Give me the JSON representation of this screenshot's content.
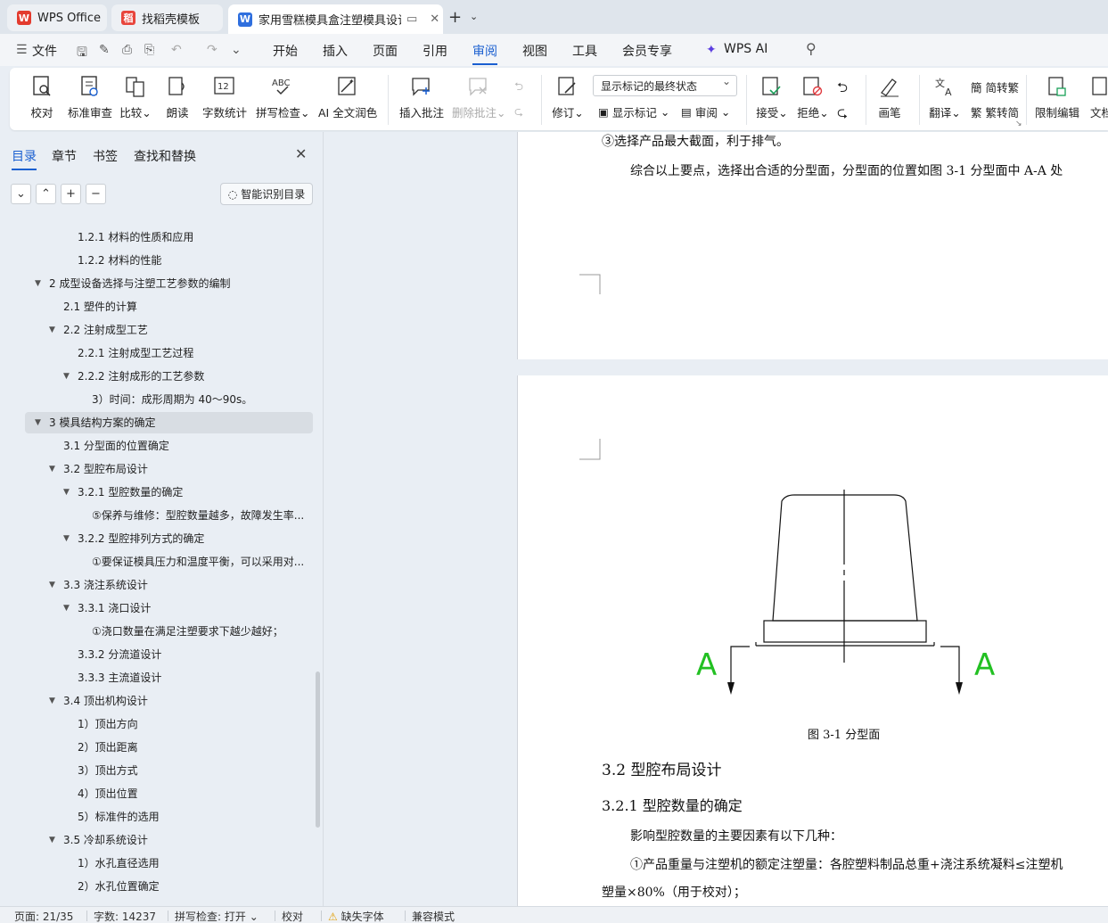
{
  "tabs": [
    {
      "label": "WPS Office"
    },
    {
      "label": "找稻壳模板"
    },
    {
      "label": "家用雪糕模具盒注塑模具设计"
    }
  ],
  "menu": {
    "file": "文件",
    "items": [
      "开始",
      "插入",
      "页面",
      "引用",
      "审阅",
      "视图",
      "工具",
      "会员专享"
    ],
    "active": "审阅",
    "ai": "WPS AI"
  },
  "ribbon": {
    "proofread": "校对",
    "std_review": "标准审查",
    "compare": "比较",
    "read_aloud": "朗读",
    "word_count": "字数统计",
    "spell_check": "拼写检查",
    "ai_polish": "AI 全文润色",
    "insert_comment": "插入批注",
    "delete_comment": "删除批注",
    "track_changes": "修订",
    "mark_state": "显示标记的最终状态",
    "show_markup": "显示标记",
    "review": "审阅",
    "accept": "接受",
    "reject": "拒绝",
    "pen": "画笔",
    "translate": "翻译",
    "to_traditional": "简转繁",
    "to_simplified": "繁转简",
    "restrict_edit": "限制编辑",
    "doc_more": "文档"
  },
  "sidebar": {
    "tabs": [
      "目录",
      "章节",
      "书签",
      "查找和替换"
    ],
    "smart_btn": "智能识别目录",
    "toc": [
      {
        "text": "1.2.1  材料的性质和应用",
        "level": 3,
        "arrow": false
      },
      {
        "text": "1.2.2 材料的性能",
        "level": 3,
        "arrow": false
      },
      {
        "text": "2  成型设备选择与注塑工艺参数的编制",
        "level": 1,
        "arrow": true
      },
      {
        "text": "2.1  塑件的计算",
        "level": 2,
        "arrow": false
      },
      {
        "text": "2.2  注射成型工艺",
        "level": 2,
        "arrow": true
      },
      {
        "text": "2.2.1  注射成型工艺过程",
        "level": 3,
        "arrow": false
      },
      {
        "text": "2.2.2  注射成形的工艺参数",
        "level": 3,
        "arrow": true
      },
      {
        "text": "3）时间：成形周期为 40～90s。",
        "level": 4,
        "arrow": false
      },
      {
        "text": "3  模具结构方案的确定",
        "level": 1,
        "arrow": true,
        "selected": true
      },
      {
        "text": "3.1  分型面的位置确定",
        "level": 2,
        "arrow": false
      },
      {
        "text": "3.2  型腔布局设计",
        "level": 2,
        "arrow": true
      },
      {
        "text": "3.2.1  型腔数量的确定",
        "level": 3,
        "arrow": true
      },
      {
        "text": "⑤保养与维修：型腔数量越多，故障发生率...",
        "level": 4,
        "arrow": false
      },
      {
        "text": "3.2.2  型腔排列方式的确定",
        "level": 3,
        "arrow": true
      },
      {
        "text": "①要保证模具压力和温度平衡，可以采用对...",
        "level": 4,
        "arrow": false
      },
      {
        "text": "3.3  浇注系统设计",
        "level": 2,
        "arrow": true
      },
      {
        "text": "3.3.1  浇口设计",
        "level": 3,
        "arrow": true
      },
      {
        "text": "①浇口数量在满足注塑要求下越少越好；",
        "level": 4,
        "arrow": false
      },
      {
        "text": "3.3.2  分流道设计",
        "level": 3,
        "arrow": false
      },
      {
        "text": "3.3.3  主流道设计",
        "level": 3,
        "arrow": false
      },
      {
        "text": "3.4  顶出机构设计",
        "level": 2,
        "arrow": true
      },
      {
        "text": "1）顶出方向",
        "level": 3,
        "arrow": false
      },
      {
        "text": "2）顶出距离",
        "level": 3,
        "arrow": false
      },
      {
        "text": "3）顶出方式",
        "level": 3,
        "arrow": false
      },
      {
        "text": "4）顶出位置",
        "level": 3,
        "arrow": false
      },
      {
        "text": "5）标准件的选用",
        "level": 3,
        "arrow": false
      },
      {
        "text": "3.5  冷却系统设计",
        "level": 2,
        "arrow": true
      },
      {
        "text": "1）水孔直径选用",
        "level": 3,
        "arrow": false
      },
      {
        "text": "2）水孔位置确定",
        "level": 3,
        "arrow": false
      }
    ]
  },
  "document": {
    "p1_line1": "③选择产品最大截面，利于排气。",
    "p1_line2": "综合以上要点，选择出合适的分型面，分型面的位置如图 3-1 分型面中 A-A 处",
    "section_label_a": "A",
    "figure_caption": "图 3-1 分型面",
    "h_32": "3.2  型腔布局设计",
    "h_321": "3.2.1  型腔数量的确定",
    "para1": "影响型腔数量的主要因素有以下几种：",
    "para2": "①产品重量与注塑机的额定注塑量：各腔塑料制品总重+浇注系统凝料≤注塑机",
    "para3": "塑量×80%（用于校对）；"
  },
  "status": {
    "page": "页面: 21/35",
    "words": "字数: 14237",
    "spell": "拼写检查: 打开",
    "proof": "校对",
    "missing_font": "缺失字体",
    "compat": "兼容模式"
  },
  "colors": {
    "accent": "#1a5fd0",
    "section_marker": "#22c022",
    "wps_red": "#e33b2e"
  }
}
